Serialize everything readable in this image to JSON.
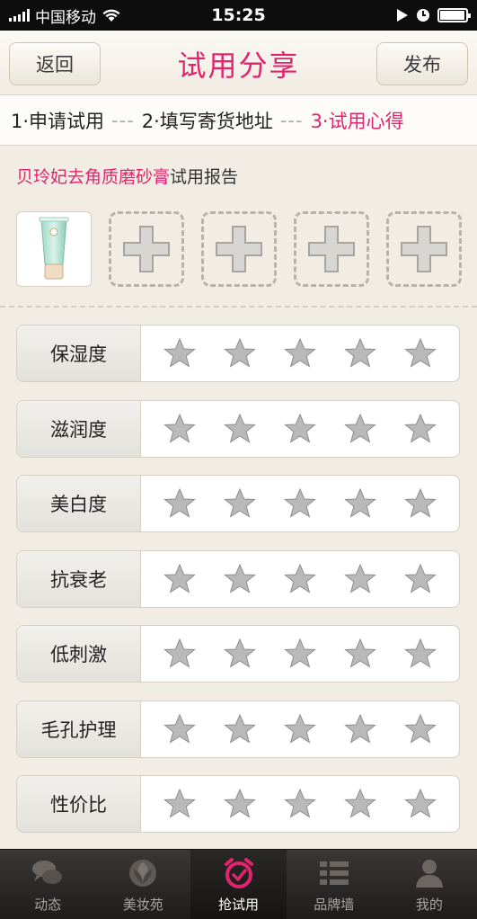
{
  "status_bar": {
    "carrier": "中国移动",
    "time": "15:25",
    "icons": [
      "signal-icon",
      "wifi-icon",
      "play-icon",
      "clock-icon",
      "battery-icon"
    ],
    "battery_level": 0.95
  },
  "nav": {
    "back_label": "返回",
    "title": "试用分享",
    "publish_label": "发布",
    "accent_color": "#e2246e"
  },
  "steps": [
    {
      "label": "1·申请试用",
      "active": false
    },
    {
      "label": "2·填写寄货地址",
      "active": false
    },
    {
      "label": "3·试用心得",
      "active": true
    }
  ],
  "step_separator": "---",
  "product": {
    "name": "贝玲妃去角质磨砂膏",
    "suffix": "试用报告"
  },
  "photos": {
    "thumbnail": "product-tube-image",
    "add_slots": 4,
    "add_icon": "plus-icon"
  },
  "ratings": [
    {
      "label": "保湿度",
      "stars": 0,
      "max": 5
    },
    {
      "label": "滋润度",
      "stars": 0,
      "max": 5
    },
    {
      "label": "美白度",
      "stars": 0,
      "max": 5
    },
    {
      "label": "抗衰老",
      "stars": 0,
      "max": 5
    },
    {
      "label": "低刺激",
      "stars": 0,
      "max": 5
    },
    {
      "label": "毛孔护理",
      "stars": 0,
      "max": 5
    },
    {
      "label": "性价比",
      "stars": 0,
      "max": 5
    }
  ],
  "tabs": [
    {
      "label": "动态",
      "icon": "chat-bubbles-icon",
      "active": false
    },
    {
      "label": "美妆苑",
      "icon": "rose-icon",
      "active": false
    },
    {
      "label": "抢试用",
      "icon": "alarm-clock-icon",
      "active": true
    },
    {
      "label": "品牌墙",
      "icon": "list-icon",
      "active": false
    },
    {
      "label": "我的",
      "icon": "user-icon",
      "active": false
    }
  ]
}
